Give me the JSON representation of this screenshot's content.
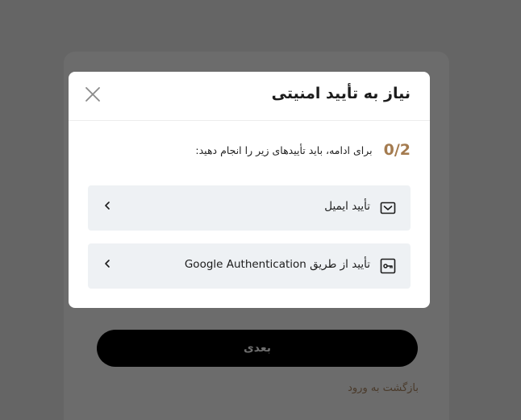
{
  "modal": {
    "title": "نیاز به تأیید امنیتی",
    "progress": {
      "count": "0/2",
      "text": "برای ادامه، باید تأییدهای زیر را انجام دهید:"
    },
    "options": [
      {
        "label": "تأیید ایمیل",
        "icon": "envelope-icon"
      },
      {
        "label": "تأیید از طریق Google Authentication",
        "icon": "key-icon"
      }
    ]
  },
  "background": {
    "next_button_label": "بعدی",
    "back_link_label": "بازگشت به ورود"
  },
  "colors": {
    "accent": "#a47b4f",
    "overlay": "#656565",
    "option_bg": "#eef1f4",
    "primary_button": "#000000"
  }
}
